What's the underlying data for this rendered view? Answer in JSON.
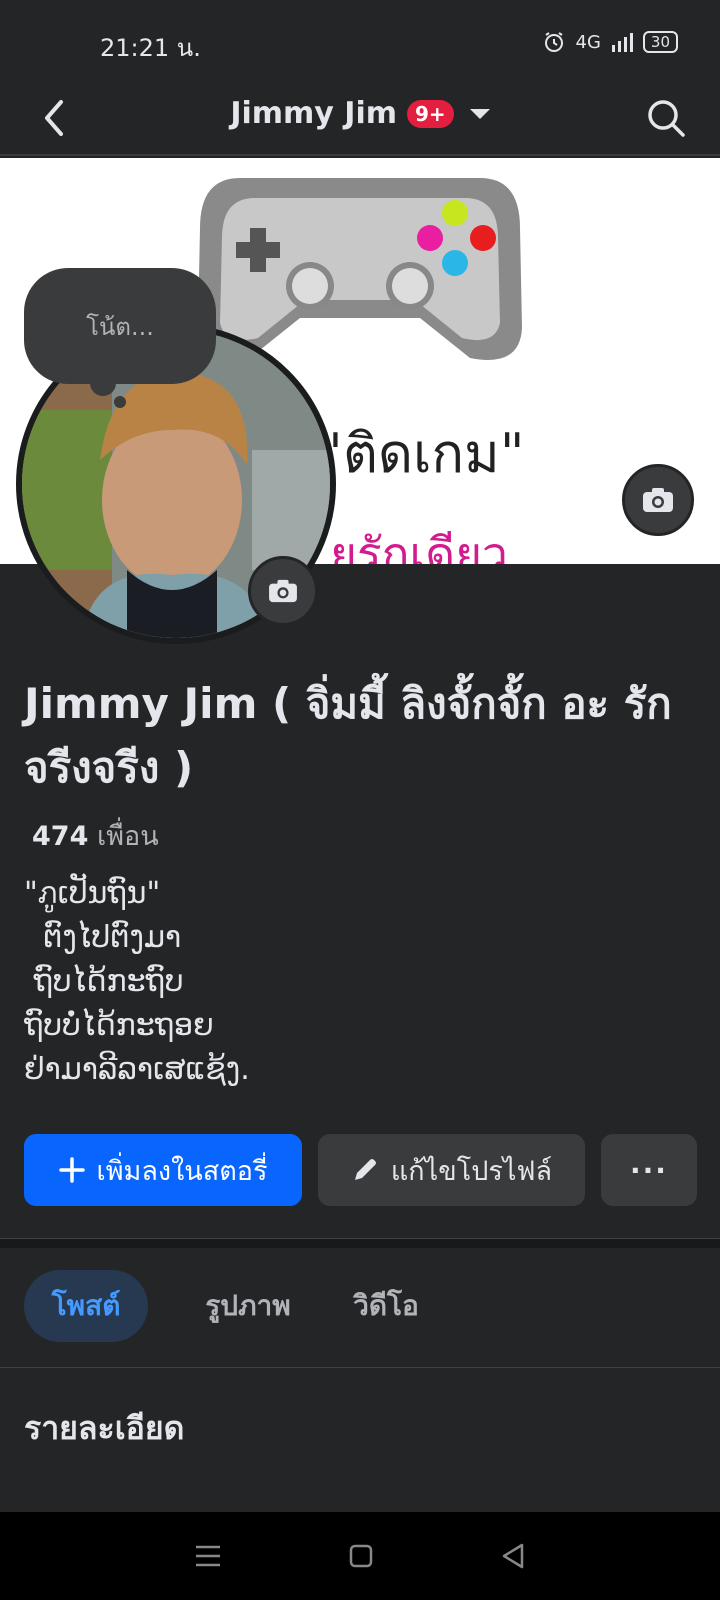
{
  "status_bar": {
    "time": "21:21 น.",
    "network": "4G",
    "battery": "30"
  },
  "nav": {
    "title": "Jimmy Jim",
    "badge": "9+",
    "back_icon": "back-arrow-icon",
    "search_icon": "search-icon"
  },
  "cover": {
    "text_line1": "\"ติดเกม\"",
    "text_line2": "ยรักเดียว",
    "camera_icon": "camera-icon"
  },
  "note": {
    "placeholder": "โน้ต..."
  },
  "profile": {
    "name": "Jimmy Jim ( จิ่มมี้ ลิงจั้กจั้ก อะ รักจรีงจรีง )",
    "friends_count": "474",
    "friends_label": "เพื่อน",
    "bio": "\"ภູເປັນຖົນ\"\n  ຕົງໄປຕົງມາ\n ຖົບໄດ້ກະຖົບ\nຖົບບໍ່ໄດ້ກະຖອຍ\nຢ່າມາລີລາເສແຊ້ງ."
  },
  "actions": {
    "add_story": "เพิ่มลงในสตอรี่",
    "edit_profile": "แก้ไขโปรไฟล์",
    "more": "···"
  },
  "tabs": {
    "posts": "โพสต์",
    "photos": "รูปภาพ",
    "videos": "วิดีโอ"
  },
  "details": {
    "title": "รายละเอียด"
  },
  "colors": {
    "background": "#242526",
    "primary_button": "#0866ff",
    "badge": "#e41e3f",
    "active_tab_text": "#4599ff"
  }
}
